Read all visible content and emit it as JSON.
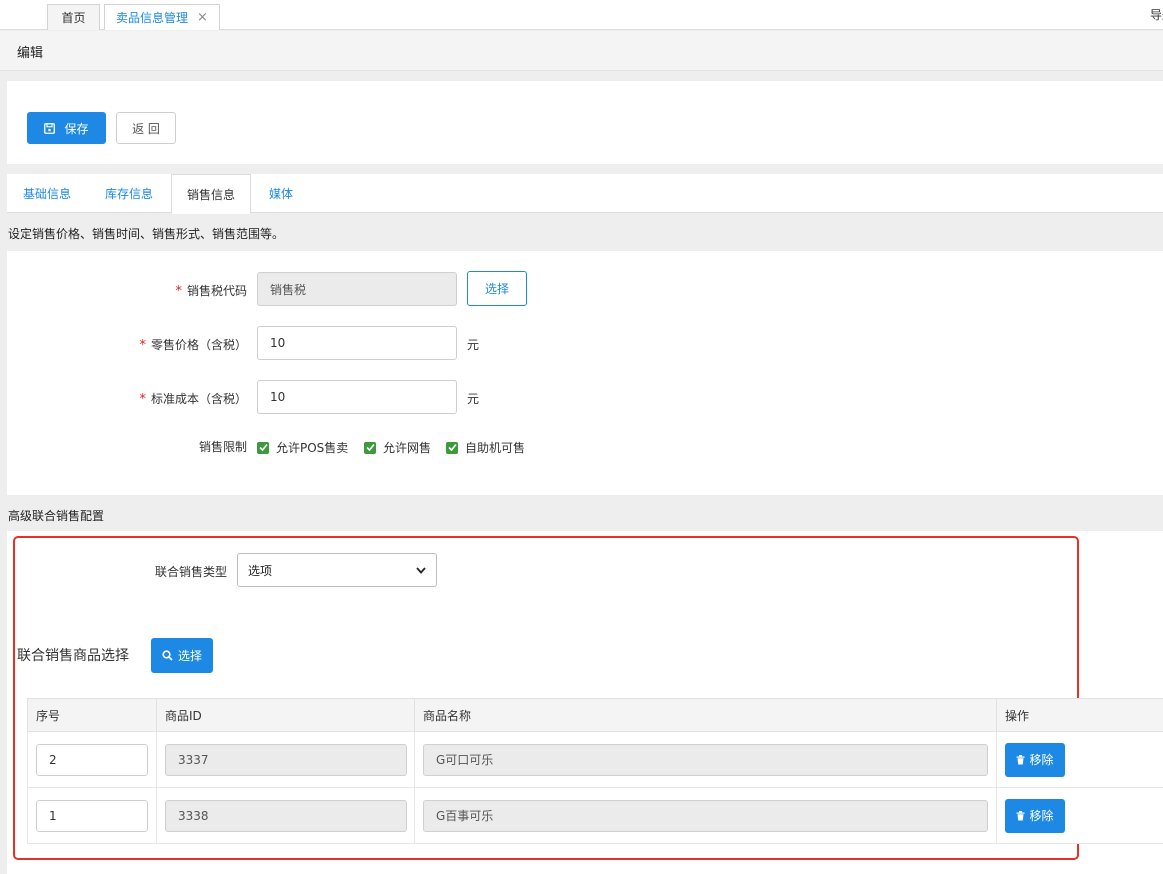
{
  "top_tabs": [
    {
      "label": "首页"
    },
    {
      "label": "卖品信息管理",
      "close": "×"
    }
  ],
  "nav_right": "导航",
  "page_header": "编辑",
  "toolbar": {
    "save_label": "保存",
    "back_label": "返 回"
  },
  "content_tabs": [
    {
      "label": "基础信息"
    },
    {
      "label": "库存信息"
    },
    {
      "label": "销售信息"
    },
    {
      "label": "媒体"
    }
  ],
  "active_tab": "销售信息",
  "description": "设定销售价格、销售时间、销售形式、销售范围等。",
  "form": {
    "tax_code": {
      "required": "*",
      "label": "销售税代码",
      "value": "销售税",
      "button": "选择"
    },
    "retail_price": {
      "required": "*",
      "label": "零售价格（含税）",
      "value": "10",
      "unit": "元"
    },
    "std_cost": {
      "required": "*",
      "label": "标准成本（含税）",
      "value": "10",
      "unit": "元"
    },
    "sale_limit": {
      "label": "销售限制",
      "options": [
        {
          "label": "允许POS售卖",
          "checked": true
        },
        {
          "label": "允许网售",
          "checked": true
        },
        {
          "label": "自助机可售",
          "checked": true
        }
      ]
    }
  },
  "advanced": {
    "title": "高级联合销售配置",
    "joint_type": {
      "label": "联合销售类型",
      "value": "选项"
    },
    "product_select": {
      "title": "联合销售商品选择",
      "button": "选择"
    },
    "table": {
      "headers": [
        "序号",
        "商品ID",
        "商品名称",
        "操作"
      ],
      "rows": [
        {
          "seq": "2",
          "id": "3337",
          "name": "G可口可乐",
          "action": "移除"
        },
        {
          "seq": "1",
          "id": "3338",
          "name": "G百事可乐",
          "action": "移除"
        }
      ]
    }
  },
  "colors": {
    "accent": "#1d89e4",
    "required": "#e02020",
    "highlight_frame": "#e8302a",
    "checkbox": "#3c9a3c"
  }
}
